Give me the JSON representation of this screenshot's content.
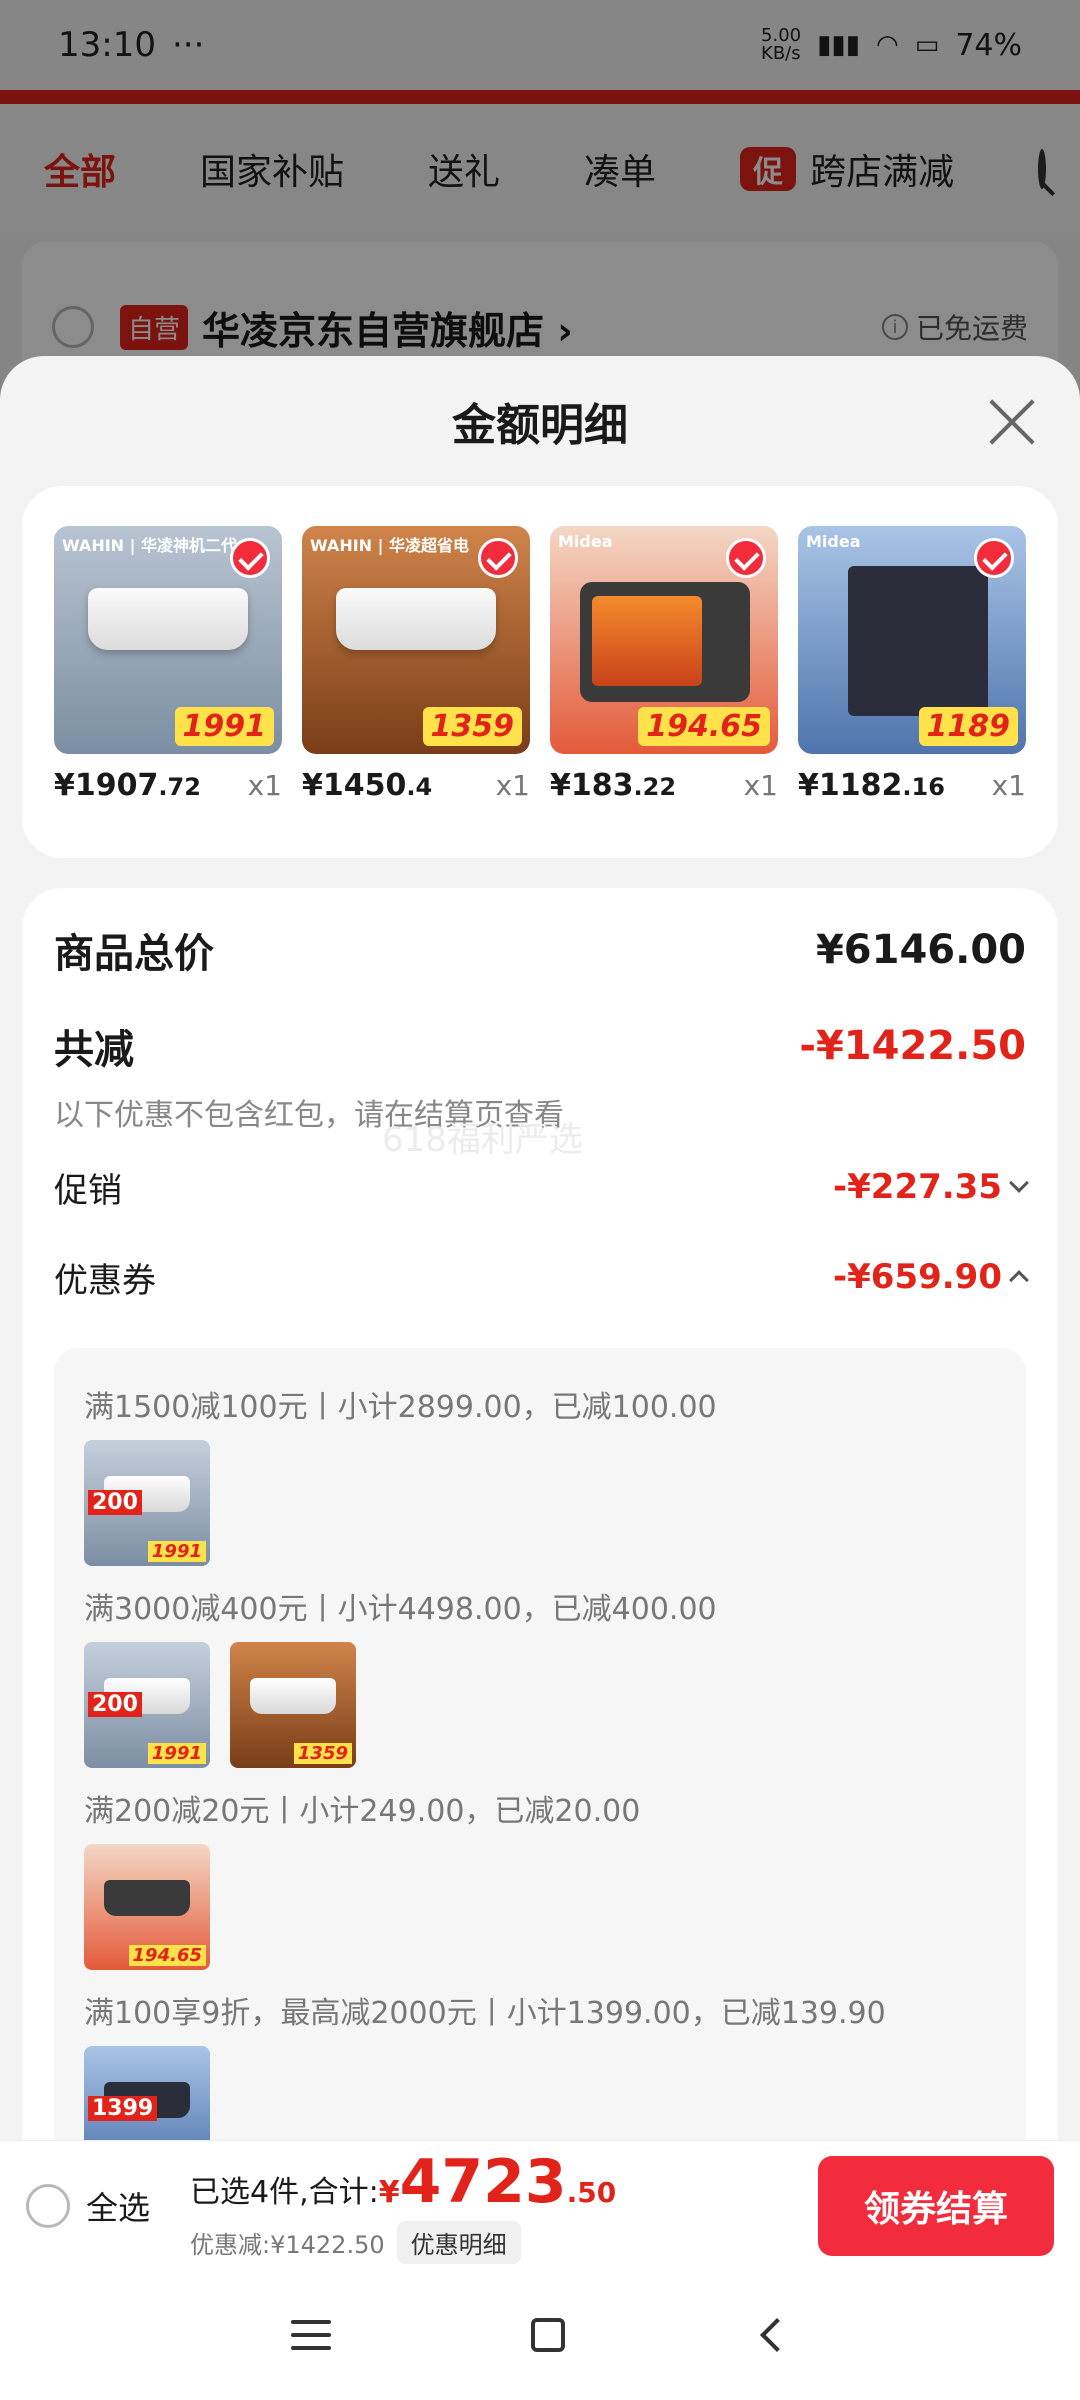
{
  "status_bar": {
    "time": "13:10",
    "net_speed": "5.00\nKB/s",
    "battery": "74%"
  },
  "tabs": [
    {
      "label": "全部",
      "active": true
    },
    {
      "label": "国家补贴"
    },
    {
      "label": "送礼"
    },
    {
      "label": "凑单"
    },
    {
      "label": "跨店满减",
      "promo_tag": "促"
    }
  ],
  "shop": {
    "self_tag": "自营",
    "name": "华凌京东自营旗舰店 ›",
    "shipping": "已免运费"
  },
  "sheet": {
    "title": "金额明细"
  },
  "products": [
    {
      "brand": "WAHIN | 华凌神机二代",
      "price_int": "¥1907",
      "price_dec": ".72",
      "qty": "x1",
      "badge": "1991",
      "bg": "#9aa8b8"
    },
    {
      "brand": "WAHIN | 华凌超省电",
      "price_int": "¥1450",
      "price_dec": ".4",
      "qty": "x1",
      "badge": "1359",
      "bg": "#b5672f"
    },
    {
      "brand": "Midea",
      "price_int": "¥183",
      "price_dec": ".22",
      "qty": "x1",
      "badge": "194.65",
      "bg": "#e45a3a"
    },
    {
      "brand": "Midea",
      "price_int": "¥1182",
      "price_dec": ".16",
      "qty": "x1",
      "badge": "1189",
      "bg": "#5b86c0"
    }
  ],
  "summary": {
    "total_label": "商品总价",
    "total_value": "¥6146.00",
    "reduce_label": "共减",
    "reduce_value": "-¥1422.50",
    "note": "以下优惠不包含红包，请在结算页查看",
    "watermark": "618福利严选",
    "promo_label": "促销",
    "promo_value": "-¥227.35",
    "coupon_label": "优惠券",
    "coupon_value": "-¥659.90"
  },
  "coupons": [
    {
      "line": "满1500减100元丨小计2899.00，已减100.00"
    },
    {
      "line": "满3000减400元丨小计4498.00，已减400.00"
    },
    {
      "line": "满200减20元丨小计249.00，已减20.00"
    },
    {
      "line": "满100享9折，最高减2000元丨小计1399.00，已减139.90"
    }
  ],
  "checkout": {
    "select_all": "全选",
    "selected_text": "已选4件,合计:",
    "currency": "¥",
    "total_int": "4723",
    "total_dec": ".50",
    "discount_text": "优惠减:¥1422.50",
    "detail_pill": "优惠明细",
    "button": "领券结算"
  },
  "colors": {
    "accent": "#e2231a",
    "button": "#f22c3d"
  }
}
